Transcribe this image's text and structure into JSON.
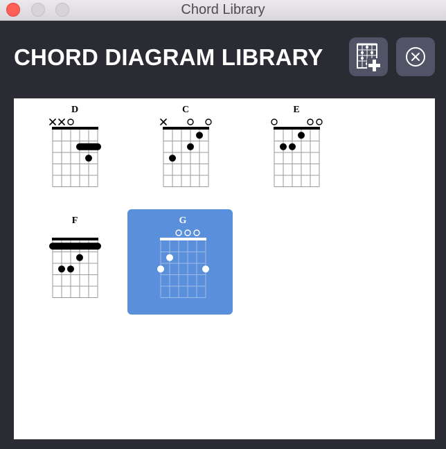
{
  "window": {
    "title": "Chord Library"
  },
  "header": {
    "title": "CHORD DIAGRAM LIBRARY",
    "add_button_icon": "add-chord-diagram-icon",
    "close_button_icon": "close-circle-icon"
  },
  "colors": {
    "background": "#2a2b33",
    "panel": "#ffffff",
    "button": "#515466",
    "selected": "#5a8fdb"
  },
  "chords": [
    {
      "name": "D",
      "selected": false,
      "strings": [
        "x",
        "x",
        "o",
        "",
        "",
        ""
      ],
      "dots": [
        [
          5,
          3
        ]
      ],
      "barres": [
        [
          4,
          6,
          2
        ]
      ]
    },
    {
      "name": "C",
      "selected": false,
      "strings": [
        "x",
        "",
        "",
        "o",
        "",
        "o"
      ],
      "dots": [
        [
          5,
          1
        ],
        [
          4,
          2
        ],
        [
          2,
          3
        ]
      ],
      "barres": []
    },
    {
      "name": "E",
      "selected": false,
      "strings": [
        "o",
        "",
        "",
        "",
        "o",
        "o"
      ],
      "dots": [
        [
          4,
          1
        ],
        [
          2,
          2
        ],
        [
          3,
          2
        ]
      ],
      "barres": []
    },
    {
      "name": "F",
      "selected": false,
      "strings": [
        "",
        "",
        "",
        "",
        "",
        ""
      ],
      "dots": [
        [
          4,
          2
        ],
        [
          2,
          3
        ],
        [
          3,
          3
        ]
      ],
      "barres": [
        [
          1,
          6,
          1
        ]
      ]
    },
    {
      "name": "G",
      "selected": true,
      "strings": [
        "",
        "",
        "o",
        "o",
        "o",
        ""
      ],
      "dots": [
        [
          2,
          2
        ],
        [
          1,
          3
        ],
        [
          6,
          3
        ]
      ],
      "barres": []
    }
  ]
}
